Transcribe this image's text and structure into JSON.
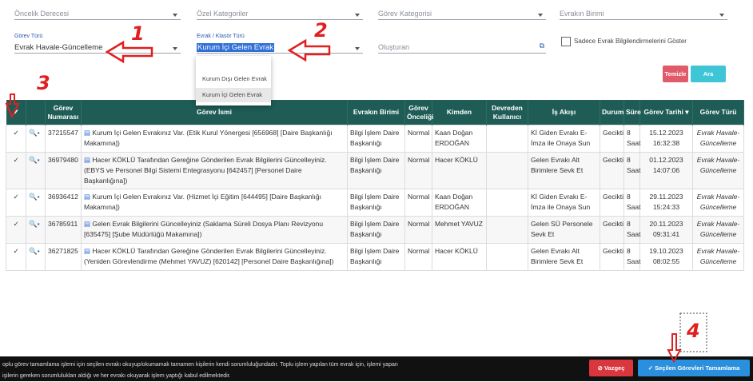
{
  "filters": {
    "oncelik_placeholder": "Öncelik Derecesi",
    "ozel_kategori_placeholder": "Özel Kategoriler",
    "gorev_kategorisi_placeholder": "Görev Kategorisi",
    "evrakin_birimi_placeholder": "Evrakın Birimi",
    "gorev_turu_label": "Görev Türü",
    "gorev_turu_value": "Evrak Havale-Güncelleme",
    "evrak_klasor_label": "Evrak / Klasör Türü",
    "evrak_klasor_value": "Kurum İçi Gelen Evrak",
    "olusturan_placeholder": "Oluşturan",
    "sadece_label": "Sadece Evrak Bilgilendirmelerini Göster",
    "temizle_label": "Temizle",
    "ara_label": "Ara"
  },
  "dropdown_options": [
    "Kurum Dışı Gelen Evrak",
    "Kurum İçi Gelen Evrak"
  ],
  "table": {
    "headers": {
      "select": "✔",
      "gorev_no": "Görev Numarası",
      "gorev_ismi": "Görev İsmi",
      "evrak_birimi": "Evrakın Birimi",
      "oncelik": "Görev Önceliği",
      "kimden": "Kimden",
      "devreden": "Devreden Kullanıcı",
      "is_akisi": "İş Akışı",
      "durum": "Durum",
      "sure": "Süre",
      "tarih": "Görev Tarihi",
      "turu": "Görev Türü"
    },
    "rows": [
      {
        "no": "37215547",
        "isim": "Kurum İçi Gelen Evrakınız Var. (Etik Kurul Yönergesi [656968] [Daire Başkanlığı Makamına])",
        "birim": "Bilgi İşlem Daire Başkanlığı",
        "oncelik": "Normal",
        "kimden": "Kaan Doğan ERDOĞAN",
        "devreden": "",
        "akis": "Kİ Giden Evrakı E-İmza ile Onaya Sun",
        "durum": "Gecikti",
        "sure": "8 Saat",
        "tarih": "15.12.2023 16:32:38",
        "turu": "Evrak Havale-Güncelleme"
      },
      {
        "no": "36979480",
        "isim": "Hacer KÖKLÜ Tarafından Gereğine Gönderilen Evrak Bilgilerini Güncelleyiniz. (EBYS ve Personel Bilgi Sistemi Entegrasyonu [642457] [Personel Daire Başkanlığına])",
        "birim": "Bilgi İşlem Daire Başkanlığı",
        "oncelik": "Normal",
        "kimden": "Hacer KÖKLÜ",
        "devreden": "",
        "akis": "Gelen Evrakı Alt Birimlere Sevk Et",
        "durum": "Gecikti",
        "sure": "8 Saat",
        "tarih": "01.12.2023 14:07:06",
        "turu": "Evrak Havale-Güncelleme"
      },
      {
        "no": "36936412",
        "isim": "Kurum İçi Gelen Evrakınız Var. (Hizmet İçi Eğitim [644495] [Daire Başkanlığı Makamına])",
        "birim": "Bilgi İşlem Daire Başkanlığı",
        "oncelik": "Normal",
        "kimden": "Kaan Doğan ERDOĞAN",
        "devreden": "",
        "akis": "Kİ Giden Evrakı E-İmza ile Onaya Sun",
        "durum": "Gecikti",
        "sure": "8 Saat",
        "tarih": "29.11.2023 15:24:33",
        "turu": "Evrak Havale-Güncelleme"
      },
      {
        "no": "36785911",
        "isim": "Gelen Evrak Bilgilerini Güncelleyiniz (Saklama Süreli Dosya Planı Revizyonu [635475] [Şube Müdürlüğü Makamına])",
        "birim": "Bilgi İşlem Daire Başkanlığı",
        "oncelik": "Normal",
        "kimden": "Mehmet YAVUZ",
        "devreden": "",
        "akis": "Gelen SÜ Personele Sevk Et",
        "durum": "Gecikti",
        "sure": "8 Saat",
        "tarih": "20.11.2023 09:31:41",
        "turu": "Evrak Havale-Güncelleme"
      },
      {
        "no": "36271825",
        "isim": "Hacer KÖKLÜ Tarafından Gereğine Gönderilen Evrak Bilgilerini Güncelleyiniz. (Yeniden Görevlendirme (Mehmet YAVUZ) [620142] [Personel Daire Başkanlığına])",
        "birim": "Bilgi İşlem Daire Başkanlığı",
        "oncelik": "Normal",
        "kimden": "Hacer KÖKLÜ",
        "devreden": "",
        "akis": "Gelen Evrakı Alt Birimlere Sevk Et",
        "durum": "Gecikti",
        "sure": "8 Saat",
        "tarih": "19.10.2023 08:02:55",
        "turu": "Evrak Havale-Güncelleme"
      }
    ]
  },
  "footer": {
    "notice_line1": "oplu görev tamamlama işlemi için seçilen evrakı okuyup/okumamak tamamen kişilerin kendi sorumluluğundadır. Toplu işlem yapılan tüm evrak için, işlemi yapan",
    "notice_line2": "işilerin gereken sorumlulukları aldığı ve her evrakı okuyarak işlem yaptığı kabul edilmektedir.",
    "vazgec_label": "Vazgeç",
    "tamamla_label": "Seçilen Görevleri Tamamlama"
  },
  "annotations": [
    "1",
    "2",
    "3",
    "4"
  ],
  "colors": {
    "header_bg": "#1f5c56",
    "accent_red": "#e02020",
    "ara_bg": "#3ec6d6",
    "temizle_bg": "#e05a6a",
    "vazgec_bg": "#d9363e",
    "tamamla_bg": "#2a8fdc"
  }
}
